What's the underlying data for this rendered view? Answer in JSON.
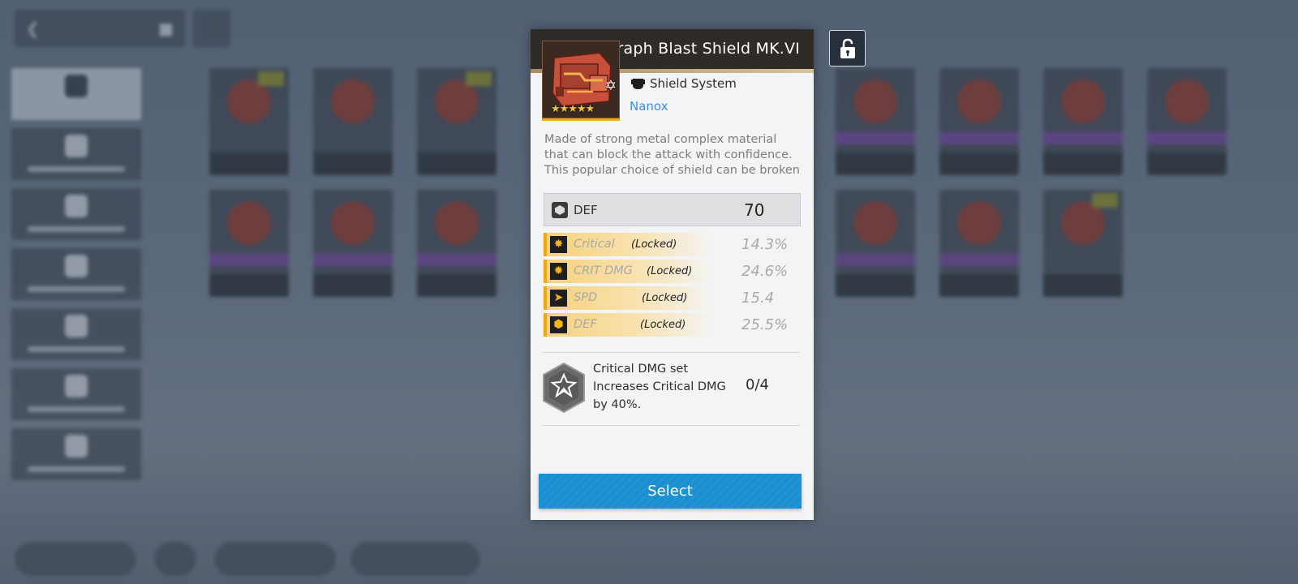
{
  "item": {
    "name": "·raph Blast Shield MK.VI",
    "type": "Shield System",
    "brand": "Nanox",
    "stars": "★★★★★",
    "rarity_icon": "star-badge-icon",
    "description": "Made of strong metal complex material that can block the attack with confidence. This popular choice of shield can be broken"
  },
  "main_stat": {
    "label": "DEF",
    "value": "70",
    "icon": "def-icon"
  },
  "sub_stats": [
    {
      "label": "Critical",
      "lock": "(Locked)",
      "value": "14.3%",
      "icon": "critical-icon"
    },
    {
      "label": "CRIT DMG",
      "lock": "(Locked)",
      "value": "24.6%",
      "icon": "crit-dmg-icon"
    },
    {
      "label": "SPD",
      "lock": "(Locked)",
      "value": "15.4",
      "icon": "spd-icon"
    },
    {
      "label": "DEF",
      "lock": "(Locked)",
      "value": "25.5%",
      "icon": "def-icon"
    }
  ],
  "set_bonus": {
    "title": "Critical DMG set",
    "line1": "Increases Critical DMG",
    "line2": "by 40%.",
    "progress": "0/4",
    "icon": "set-bonus-icon"
  },
  "actions": {
    "select_label": "Select",
    "lock_icon": "unlock-icon"
  },
  "colors": {
    "header": "#2f2b27",
    "accent_gold": "#f1a80f",
    "select_button": "#1b8fcf",
    "brand_link": "#3a8fdc"
  }
}
